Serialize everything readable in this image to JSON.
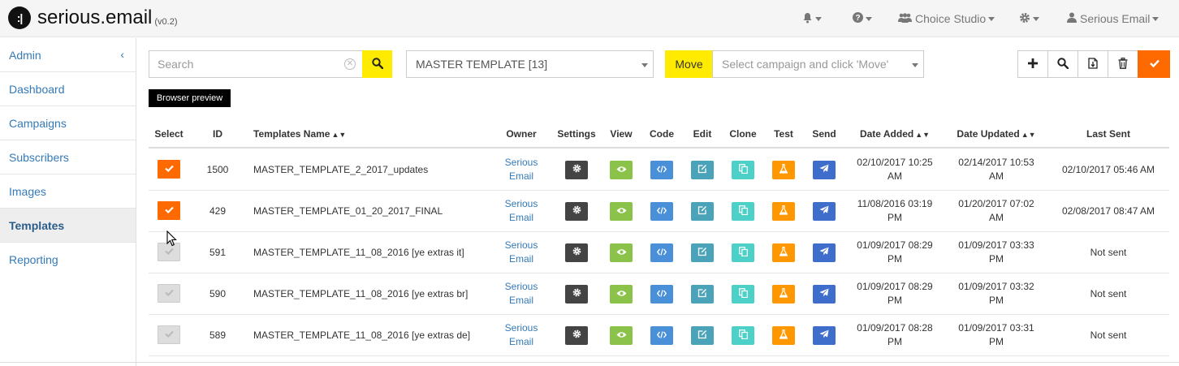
{
  "app": {
    "logo_mark": ":|",
    "name": "serious.email",
    "version": "(v0.2)"
  },
  "topnav": {
    "bell_icon": "bell-icon",
    "help_icon": "question-icon",
    "team_label": "Choice Studio",
    "settings_icon": "gear-icon",
    "user_label": "Serious Email"
  },
  "sidebar": {
    "items": [
      {
        "label": "Admin",
        "collapse_glyph": "‹"
      },
      {
        "label": "Dashboard"
      },
      {
        "label": "Campaigns"
      },
      {
        "label": "Subscribers"
      },
      {
        "label": "Images"
      },
      {
        "label": "Templates"
      },
      {
        "label": "Reporting"
      }
    ],
    "active": "Templates"
  },
  "toolbar": {
    "search_placeholder": "Search",
    "template_select": "MASTER TEMPLATE [13]",
    "move_label": "Move",
    "campaign_placeholder": "Select campaign and click 'Move'",
    "actions": [
      "add-icon",
      "search-icon",
      "file-export-icon",
      "trash-icon",
      "check-icon"
    ],
    "browser_preview_label": "Browser preview"
  },
  "table": {
    "headers": {
      "select": "Select",
      "id": "ID",
      "name": "Templates Name",
      "owner": "Owner",
      "settings": "Settings",
      "view": "View",
      "code": "Code",
      "edit": "Edit",
      "clone": "Clone",
      "test": "Test",
      "send": "Send",
      "date_added": "Date Added",
      "date_updated": "Date Updated",
      "last_sent": "Last Sent"
    },
    "rows": [
      {
        "selected": true,
        "id": "1500",
        "name": "MASTER_TEMPLATE_2_2017_updates",
        "owner_1": "Serious",
        "owner_2": "Email",
        "added_1": "02/10/2017 10:25",
        "added_2": "AM",
        "updated_1": "02/14/2017 10:53",
        "updated_2": "AM",
        "last_sent": "02/10/2017 05:46 AM"
      },
      {
        "selected": true,
        "id": "429",
        "name": "MASTER_TEMPLATE_01_20_2017_FINAL",
        "owner_1": "Serious",
        "owner_2": "Email",
        "added_1": "11/08/2016 03:19",
        "added_2": "PM",
        "updated_1": "01/20/2017 07:02",
        "updated_2": "AM",
        "last_sent": "02/08/2017 08:47 AM"
      },
      {
        "selected": false,
        "id": "591",
        "name": "MASTER_TEMPLATE_11_08_2016 [ye extras it]",
        "owner_1": "Serious",
        "owner_2": "Email",
        "added_1": "01/09/2017 08:29",
        "added_2": "PM",
        "updated_1": "01/09/2017 03:33",
        "updated_2": "PM",
        "last_sent": "Not sent"
      },
      {
        "selected": false,
        "id": "590",
        "name": "MASTER_TEMPLATE_11_08_2016 [ye extras br]",
        "owner_1": "Serious",
        "owner_2": "Email",
        "added_1": "01/09/2017 08:29",
        "added_2": "PM",
        "updated_1": "01/09/2017 03:32",
        "updated_2": "PM",
        "last_sent": "Not sent"
      },
      {
        "selected": false,
        "id": "589",
        "name": "MASTER_TEMPLATE_11_08_2016 [ye extras de]",
        "owner_1": "Serious",
        "owner_2": "Email",
        "added_1": "01/09/2017 08:28",
        "added_2": "PM",
        "updated_1": "01/09/2017 03:31",
        "updated_2": "PM",
        "last_sent": "Not sent"
      }
    ]
  },
  "colors": {
    "accent_orange": "#ff6a00",
    "highlight_yellow": "#ffeb00",
    "link_blue": "#337ab7"
  }
}
